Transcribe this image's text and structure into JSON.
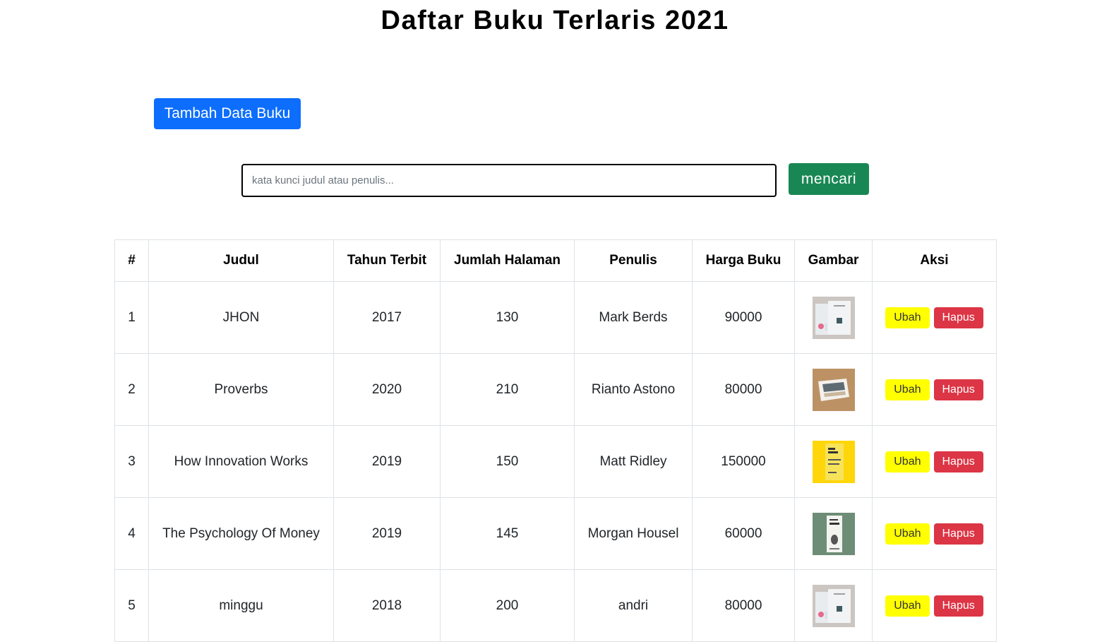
{
  "page": {
    "title": "Daftar Buku Terlaris 2021"
  },
  "toolbar": {
    "add_label": "Tambah Data Buku"
  },
  "search": {
    "placeholder": "kata kunci judul atau penulis...",
    "value": "",
    "button_label": "mencari"
  },
  "table": {
    "headers": [
      "#",
      "Judul",
      "Tahun Terbit",
      "Jumlah Halaman",
      "Penulis",
      "Harga Buku",
      "Gambar",
      "Aksi"
    ],
    "rows": [
      {
        "no": "1",
        "judul": "JHON",
        "tahun": "2017",
        "halaman": "130",
        "penulis": "Mark Berds",
        "harga": "90000",
        "gambar": "book-cover-gray-icon",
        "ubah": "Ubah",
        "hapus": "Hapus"
      },
      {
        "no": "2",
        "judul": "Proverbs",
        "tahun": "2020",
        "halaman": "210",
        "penulis": "Rianto Astono",
        "harga": "80000",
        "gambar": "book-cover-brown-icon",
        "ubah": "Ubah",
        "hapus": "Hapus"
      },
      {
        "no": "3",
        "judul": "How Innovation Works",
        "tahun": "2019",
        "halaman": "150",
        "penulis": "Matt Ridley",
        "harga": "150000",
        "gambar": "book-cover-yellow-icon",
        "ubah": "Ubah",
        "hapus": "Hapus"
      },
      {
        "no": "4",
        "judul": "The Psychology Of Money",
        "tahun": "2019",
        "halaman": "145",
        "penulis": "Morgan Housel",
        "harga": "60000",
        "gambar": "book-cover-green-icon",
        "ubah": "Ubah",
        "hapus": "Hapus"
      },
      {
        "no": "5",
        "judul": "minggu",
        "tahun": "2018",
        "halaman": "200",
        "penulis": "andri",
        "harga": "80000",
        "gambar": "book-cover-gray-icon",
        "ubah": "Ubah",
        "hapus": "Hapus"
      }
    ]
  },
  "colors": {
    "primary": "#0d6efd",
    "success": "#198754",
    "warning": "#ffff00",
    "danger": "#dc3545"
  }
}
